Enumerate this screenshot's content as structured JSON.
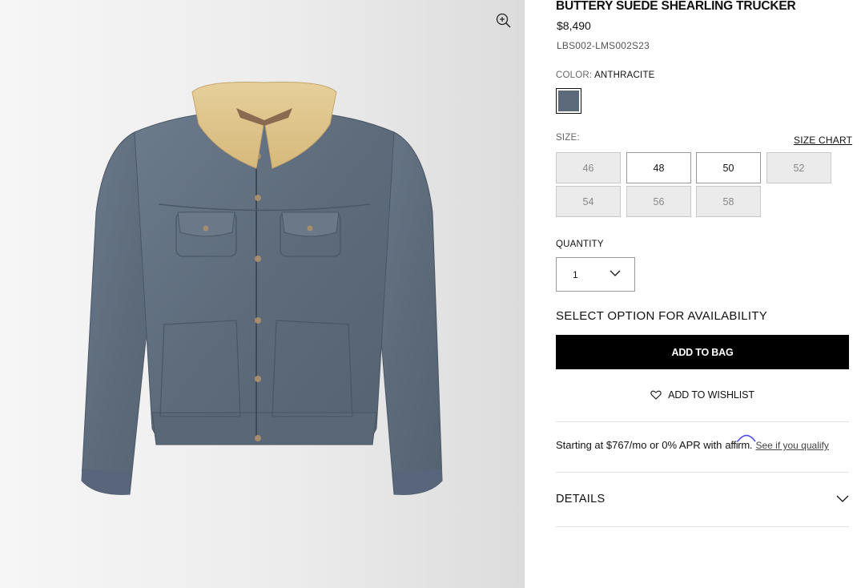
{
  "product": {
    "title": "BUTTERY SUEDE SHEARLING TRUCKER",
    "price": "$8,490",
    "sku": "LBS002-LMS002S23",
    "image_alt": "Anthracite suede trucker jacket with shearling collar"
  },
  "color": {
    "label": "COLOR:",
    "value": "ANTHRACITE",
    "swatch_hex": "#5c6a7a"
  },
  "size": {
    "label": "SIZE:",
    "chart_link": "SIZE CHART",
    "options": [
      {
        "label": "46",
        "available": false
      },
      {
        "label": "48",
        "available": true
      },
      {
        "label": "50",
        "available": true
      },
      {
        "label": "52",
        "available": false
      },
      {
        "label": "54",
        "available": false
      },
      {
        "label": "56",
        "available": false
      },
      {
        "label": "58",
        "available": false
      }
    ]
  },
  "quantity": {
    "label": "QUANTITY",
    "value": "1"
  },
  "availability_text": "SELECT OPTION FOR AVAILABILITY",
  "actions": {
    "add_to_bag": "ADD TO BAG",
    "add_to_wishlist": "ADD TO WISHLIST"
  },
  "financing": {
    "prefix": "Starting at $767/mo or 0% APR with",
    "brand": "affirm",
    "suffix": ".",
    "link": "See if you qualify"
  },
  "details": {
    "label": "DETAILS"
  },
  "icons": {
    "zoom": "zoom-in-icon",
    "heart": "heart-icon",
    "qty_chevron": "chevron-down-icon",
    "details_chevron": "chevron-down-icon"
  },
  "colors": {
    "button_bg": "#000000",
    "unavailable_size_bg": "#ebebeb",
    "affirm_arc": "#4a4af4"
  }
}
